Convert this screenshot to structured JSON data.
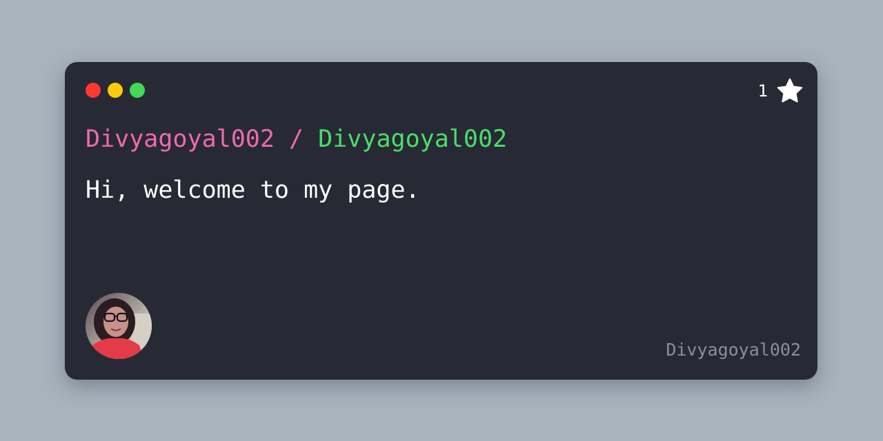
{
  "window": {
    "controls": [
      "close-dot",
      "minimize-dot",
      "maximize-dot"
    ],
    "colors": {
      "close": "#fd3a30",
      "minimize": "#fecb0b",
      "maximize": "#42d859",
      "background": "#272935",
      "page_background": "#a8b3be"
    }
  },
  "stars": {
    "count": "1",
    "icon": "star-icon"
  },
  "repo": {
    "owner": "Divyagoyal002",
    "separator": " / ",
    "name": "Divyagoyal002",
    "owner_color": "#ef6ab0",
    "name_color": "#4ade68"
  },
  "description": "Hi, welcome to my page.",
  "footer": {
    "avatar_icon": "user-avatar",
    "username": "Divyagoyal002"
  }
}
